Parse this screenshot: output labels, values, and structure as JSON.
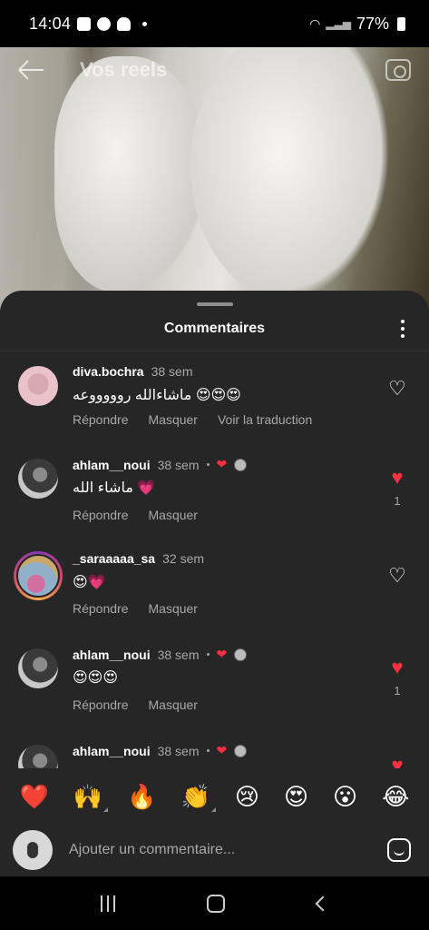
{
  "status": {
    "time": "14:04",
    "battery": "77%",
    "icons": [
      "gallery-icon",
      "shazam-icon",
      "snapchat-icon",
      "notification-dot",
      "wifi-icon",
      "signal-icon",
      "battery-icon"
    ]
  },
  "reel": {
    "title": "Vos reels"
  },
  "sheet": {
    "title": "Commentaires"
  },
  "comments": [
    {
      "user": "diva.bochra",
      "time": "38 sem",
      "text": "ماشاءالله روووووعه 😍😍😍",
      "actions": [
        "Répondre",
        "Masquer",
        "Voir la traduction"
      ],
      "liked": false,
      "likes": ""
    },
    {
      "user": "ahlam__noui",
      "time": "38 sem",
      "text": "ماشاء الله 💗",
      "actions": [
        "Répondre",
        "Masquer"
      ],
      "liked": true,
      "likes": "1",
      "creator_liked": true
    },
    {
      "user": "_saraaaaa_sa",
      "time": "32 sem",
      "text": "😍💗",
      "actions": [
        "Répondre",
        "Masquer"
      ],
      "liked": false,
      "likes": ""
    },
    {
      "user": "ahlam__noui",
      "time": "38 sem",
      "text": "😍😍😍",
      "actions": [
        "Répondre",
        "Masquer"
      ],
      "liked": true,
      "likes": "1",
      "creator_liked": true
    },
    {
      "user": "ahlam__noui",
      "time": "38 sem",
      "text": "",
      "actions": [],
      "liked": true,
      "likes": "",
      "creator_liked": true
    }
  ],
  "emoji_reactions": [
    "❤️",
    "🙌",
    "🔥",
    "👏",
    "😢",
    "😍",
    "😮",
    "😂"
  ],
  "composer": {
    "placeholder": "Ajouter un commentaire..."
  },
  "colors": {
    "sheet_bg": "#262626",
    "accent_red": "#ff3040",
    "secondary_text": "#a8a8a8"
  }
}
